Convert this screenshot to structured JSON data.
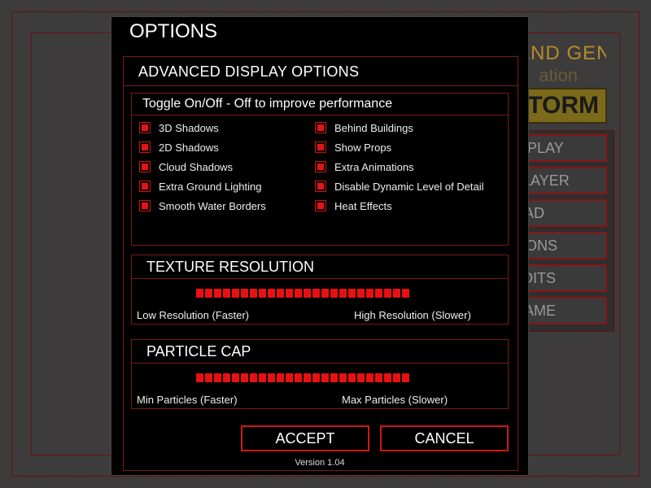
{
  "background": {
    "logo_text": "COMMAND GENERALS",
    "logo_sub": "ation",
    "storm_text": "TORM",
    "menu_items": [
      "D PLAY",
      "PLAYER",
      "OAD",
      "TIONS",
      "EDITS",
      "GAME"
    ]
  },
  "dialog": {
    "title": "OPTIONS",
    "section_title": "ADVANCED DISPLAY OPTIONS",
    "toggle": {
      "title": "Toggle On/Off - Off to improve performance",
      "left": [
        "3D Shadows",
        "2D Shadows",
        "Cloud Shadows",
        "Extra Ground Lighting",
        "Smooth Water Borders"
      ],
      "right": [
        "Behind Buildings",
        "Show Props",
        "Extra Animations",
        "Disable Dynamic Level of Detail",
        "Heat Effects"
      ]
    },
    "texture": {
      "title": "TEXTURE RESOLUTION",
      "low_label": "Low Resolution (Faster)",
      "high_label": "High Resolution (Slower)",
      "level_fraction": 1.0
    },
    "particle": {
      "title": "PARTICLE CAP",
      "low_label": "Min Particles (Faster)",
      "high_label": "Max Particles (Slower)",
      "level_fraction": 1.0
    },
    "accept_label": "ACCEPT",
    "cancel_label": "CANCEL",
    "version": "Version 1.04"
  },
  "colors": {
    "accent_red": "#e41414",
    "border_red": "#7a1a1a"
  }
}
